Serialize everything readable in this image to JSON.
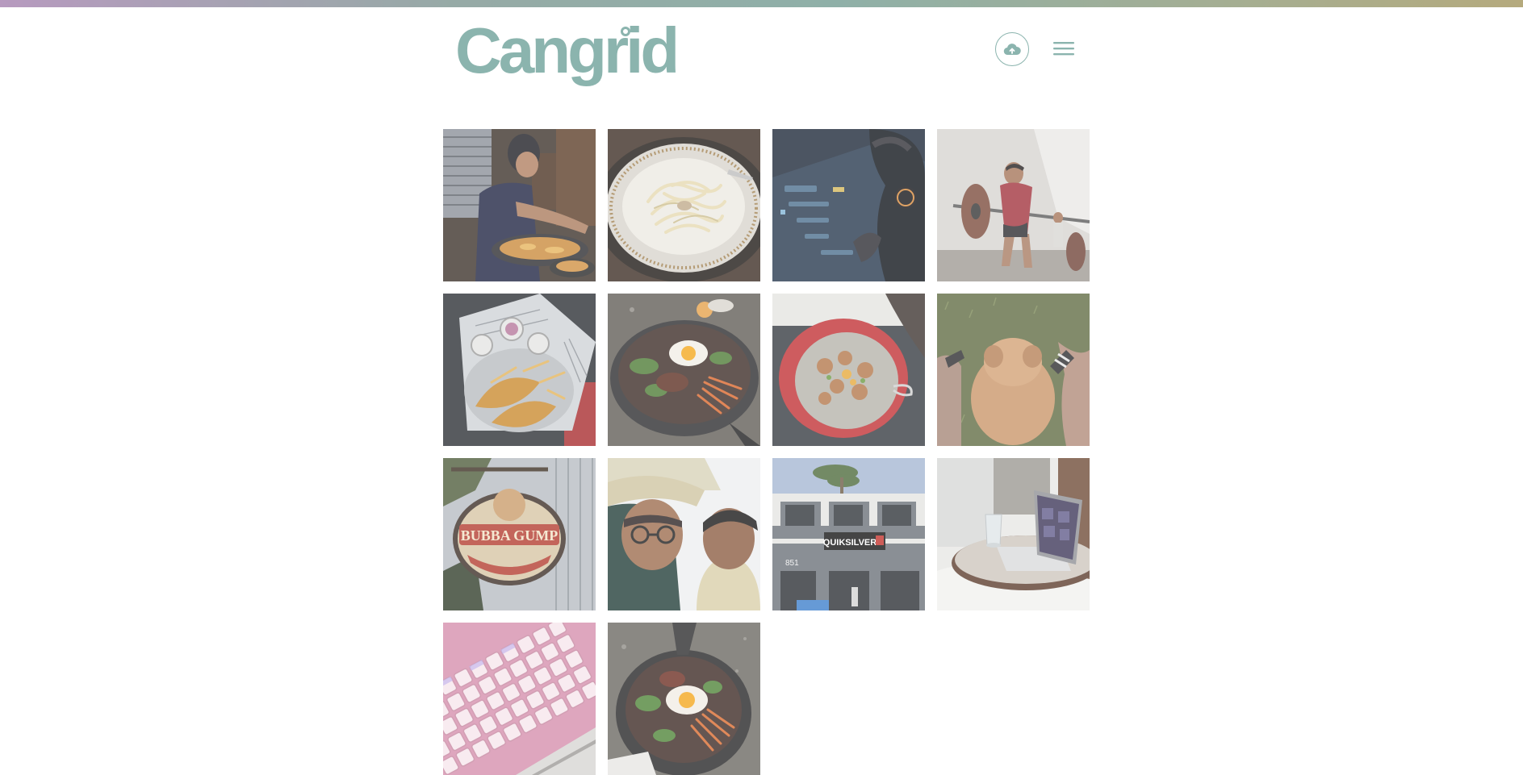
{
  "app": {
    "logo_text": "Cangrid",
    "accent_color": "#8bb4ae",
    "gradient_colors": [
      "#b79abf",
      "#8fb0a8",
      "#b5aa7d"
    ]
  },
  "header": {
    "upload_icon": "cloud-upload-icon",
    "menu_icon": "hamburger-menu-icon"
  },
  "gallery": {
    "photos": [
      {
        "subject": "person-cooking"
      },
      {
        "subject": "pasta-plate"
      },
      {
        "subject": "headphones-console"
      },
      {
        "subject": "barbell-lift"
      },
      {
        "subject": "fish-and-chips"
      },
      {
        "subject": "bibimbap-skillet"
      },
      {
        "subject": "red-bowl-dish"
      },
      {
        "subject": "puppy-on-grass"
      },
      {
        "subject": "restaurant-sign",
        "sign_text": "BUBBA GUMP"
      },
      {
        "subject": "two-person-selfie"
      },
      {
        "subject": "storefront",
        "sign_text": "QUIKSILVER",
        "address_text": "851"
      },
      {
        "subject": "laptop-on-tray"
      },
      {
        "subject": "pink-keyboard"
      },
      {
        "subject": "bibimbap-overhead"
      }
    ]
  }
}
